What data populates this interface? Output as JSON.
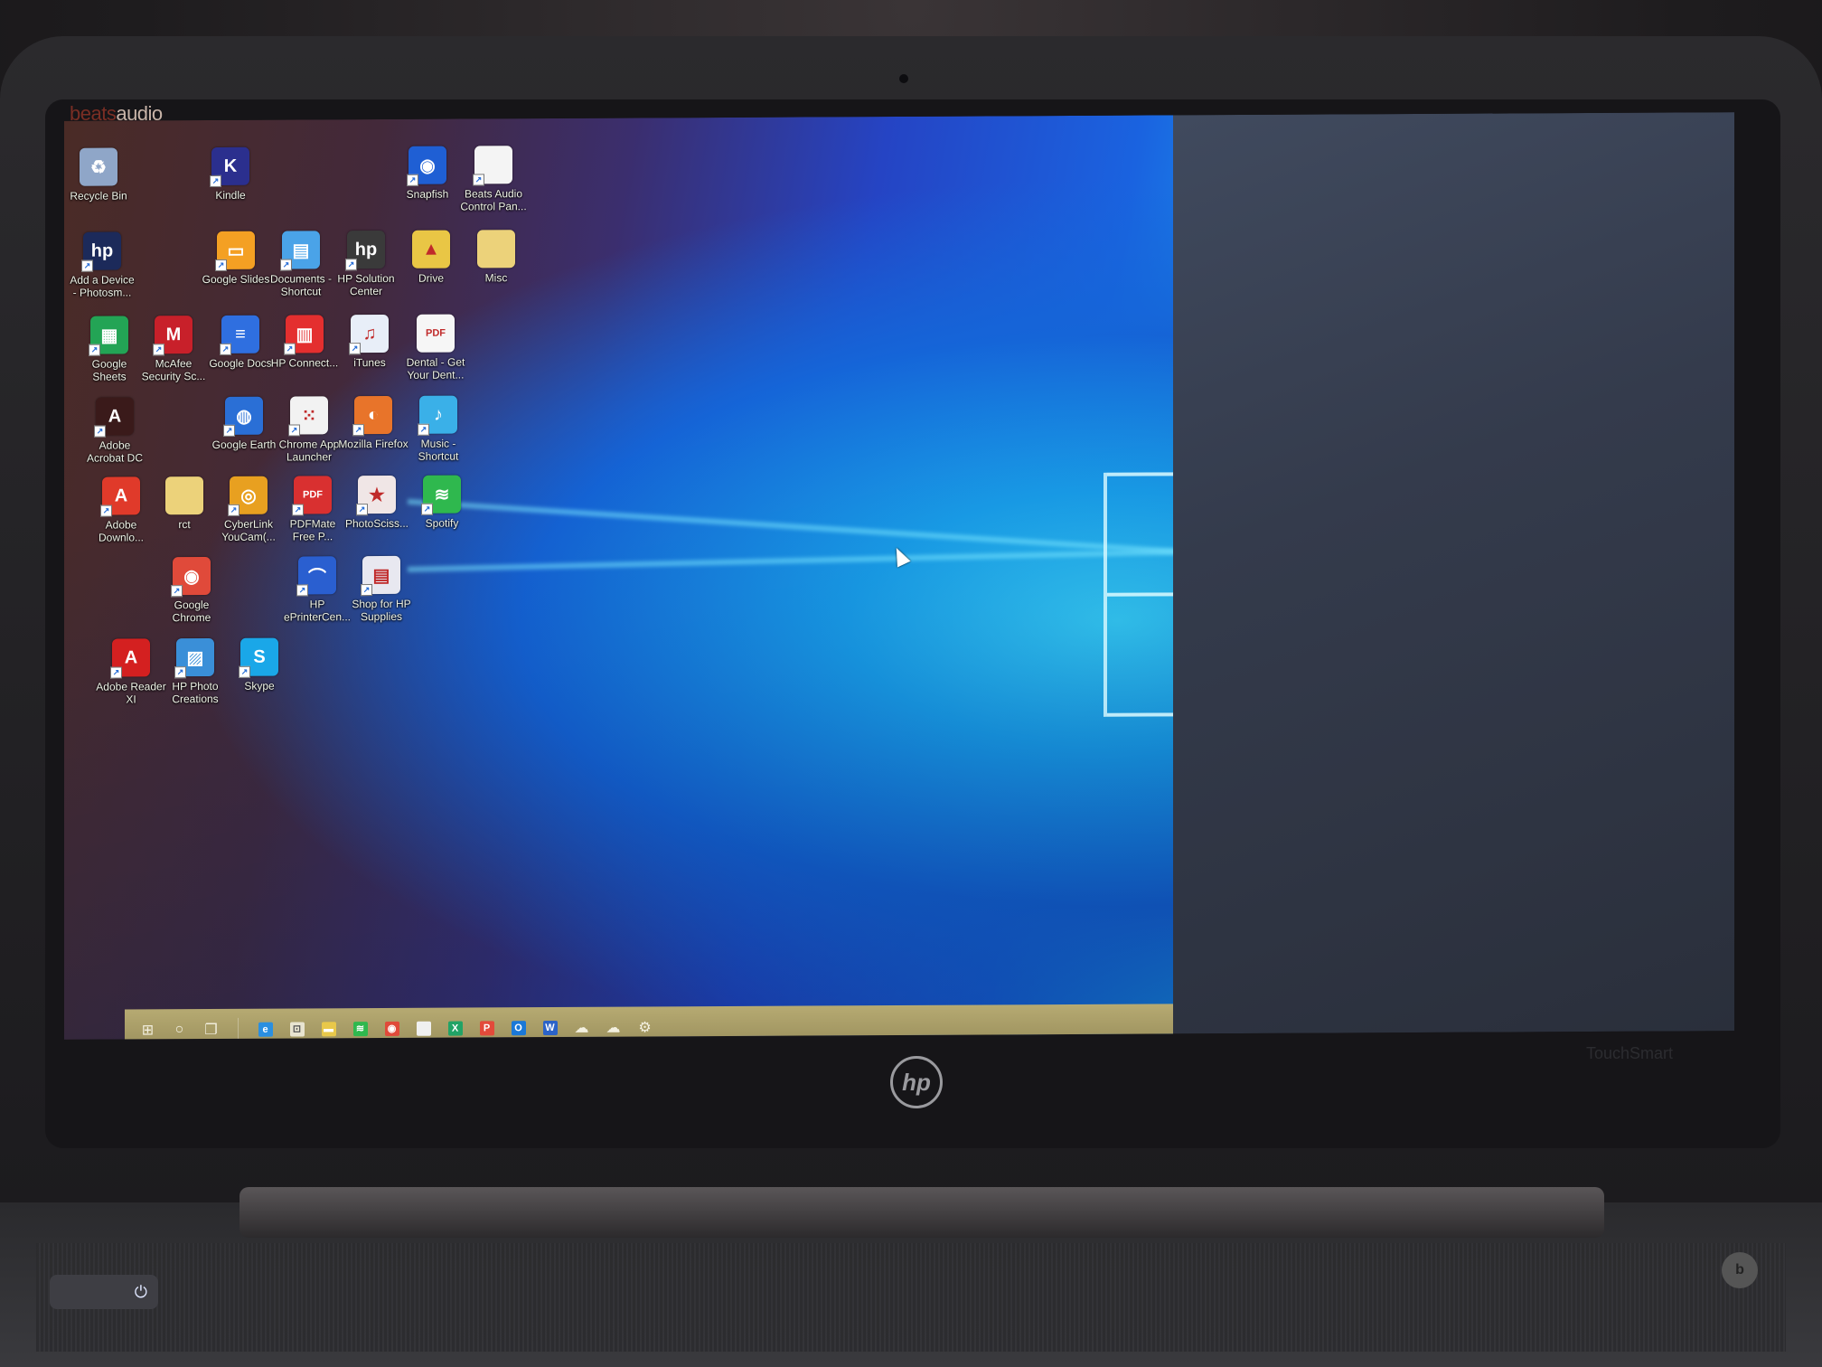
{
  "branding": {
    "brand_prefix": "beats",
    "brand_suffix": "audio",
    "laptop_logo": "hp",
    "model_label": "TouchSmart"
  },
  "desktop": {
    "icons": [
      {
        "label": "Recycle Bin",
        "icon": "recycle-bin-icon",
        "color": "#8fa6c8",
        "glyph": "♻",
        "shortcut": false
      },
      {
        "label": "Kindle",
        "icon": "kindle-icon",
        "color": "#2b2f8e",
        "glyph": "K",
        "shortcut": true
      },
      {
        "label": "Snapfish",
        "icon": "snapfish-icon",
        "color": "#1f5fd4",
        "glyph": "◉",
        "shortcut": true
      },
      {
        "label": "Beats Audio Control Pan...",
        "icon": "document-icon",
        "color": "#f4f4f4",
        "glyph": "",
        "shortcut": true
      },
      {
        "label": "Add a Device - Photosm...",
        "icon": "hp-icon",
        "color": "#1c2a5a",
        "glyph": "hp",
        "shortcut": true
      },
      {
        "label": "Google Slides",
        "icon": "google-slides-icon",
        "color": "#f4a023",
        "glyph": "▭",
        "shortcut": true
      },
      {
        "label": "Documents - Shortcut",
        "icon": "documents-icon",
        "color": "#4aa3e8",
        "glyph": "▤",
        "shortcut": true
      },
      {
        "label": "HP Solution Center",
        "icon": "hp-solution-center-icon",
        "color": "#3a3a3a",
        "glyph": "hp",
        "shortcut": true
      },
      {
        "label": "Drive",
        "icon": "folder-icon",
        "color": "#e9c645",
        "glyph": "▲",
        "shortcut": false
      },
      {
        "label": "Misc",
        "icon": "folder-icon",
        "color": "#ecd27a",
        "glyph": "",
        "shortcut": false
      },
      {
        "label": "Google Sheets",
        "icon": "google-sheets-icon",
        "color": "#23a455",
        "glyph": "▦",
        "shortcut": true
      },
      {
        "label": "McAfee Security Sc...",
        "icon": "mcafee-icon",
        "color": "#c8202a",
        "glyph": "M",
        "shortcut": true
      },
      {
        "label": "Google Docs",
        "icon": "google-docs-icon",
        "color": "#2f6fe0",
        "glyph": "≡",
        "shortcut": true
      },
      {
        "label": "HP Connect...",
        "icon": "hp-connected-music-icon",
        "color": "#e42f2f",
        "glyph": "▥",
        "shortcut": true
      },
      {
        "label": "iTunes",
        "icon": "itunes-icon",
        "color": "#e8eef8",
        "glyph": "♫",
        "shortcut": true
      },
      {
        "label": "Dental - Get Your Dent...",
        "icon": "pdf-icon",
        "color": "#f6f6f6",
        "glyph": "PDF",
        "shortcut": false
      },
      {
        "label": "Adobe Acrobat DC",
        "icon": "acrobat-icon",
        "color": "#3a1a1a",
        "glyph": "A",
        "shortcut": true
      },
      {
        "label": "Google Earth",
        "icon": "google-earth-icon",
        "color": "#2a6fd6",
        "glyph": "◍",
        "shortcut": true
      },
      {
        "label": "Chrome App Launcher",
        "icon": "chrome-app-launcher-icon",
        "color": "#f2f2f2",
        "glyph": "⁙",
        "shortcut": true
      },
      {
        "label": "Mozilla Firefox",
        "icon": "firefox-icon",
        "color": "#e8742a",
        "glyph": "◐",
        "shortcut": true
      },
      {
        "label": "Music - Shortcut",
        "icon": "music-icon",
        "color": "#3ab0e8",
        "glyph": "♪",
        "shortcut": true
      },
      {
        "label": "Adobe Downlo...",
        "icon": "adobe-icon",
        "color": "#e03a2a",
        "glyph": "A",
        "shortcut": true
      },
      {
        "label": "rct",
        "icon": "folder-icon",
        "color": "#ecd27a",
        "glyph": "",
        "shortcut": false
      },
      {
        "label": "CyberLink YouCam(...",
        "icon": "youcam-icon",
        "color": "#e8a020",
        "glyph": "◎",
        "shortcut": true
      },
      {
        "label": "PDFMate Free P...",
        "icon": "pdfmate-icon",
        "color": "#d93030",
        "glyph": "PDF",
        "shortcut": true
      },
      {
        "label": "PhotoSciss...",
        "icon": "photoscissors-icon",
        "color": "#f0e6e6",
        "glyph": "★",
        "shortcut": true
      },
      {
        "label": "Spotify",
        "icon": "spotify-icon",
        "color": "#2fb84e",
        "glyph": "≋",
        "shortcut": true
      },
      {
        "label": "Google Chrome",
        "icon": "chrome-icon",
        "color": "#e04a3a",
        "glyph": "◉",
        "shortcut": true
      },
      {
        "label": "HP ePrinterCen...",
        "icon": "hp-eprint-icon",
        "color": "#2a5fd0",
        "glyph": "⌒",
        "shortcut": true
      },
      {
        "label": "Shop for HP Supplies",
        "icon": "printer-icon",
        "color": "#e8e8f0",
        "glyph": "▤",
        "shortcut": true
      },
      {
        "label": "Adobe Reader XI",
        "icon": "adobe-reader-icon",
        "color": "#d42020",
        "glyph": "A",
        "shortcut": true
      },
      {
        "label": "HP Photo Creations",
        "icon": "hp-photo-creations-icon",
        "color": "#3a8fd8",
        "glyph": "▨",
        "shortcut": true
      },
      {
        "label": "Skype",
        "icon": "skype-icon",
        "color": "#1aa7e8",
        "glyph": "S",
        "shortcut": true
      }
    ]
  },
  "taskbar": {
    "items": [
      {
        "name": "start-button",
        "icon": "windows-icon",
        "glyph": "⊞",
        "color": "",
        "active": false
      },
      {
        "name": "cortana-button",
        "icon": "search-circle-icon",
        "glyph": "○",
        "color": "",
        "active": false
      },
      {
        "name": "task-view-button",
        "icon": "task-view-icon",
        "glyph": "❐",
        "color": "",
        "active": false
      },
      {
        "name": "edge-button",
        "icon": "edge-icon",
        "glyph": "e",
        "color": "#2a8fe0",
        "active": false
      },
      {
        "name": "store-button",
        "icon": "store-icon",
        "glyph": "⊡",
        "color": "#e8e4d0",
        "active": false
      },
      {
        "name": "file-explorer-button",
        "icon": "folder-icon",
        "glyph": "▬",
        "color": "#e8c84a",
        "active": false
      },
      {
        "name": "spotify-button",
        "icon": "spotify-icon",
        "glyph": "≋",
        "color": "#2fb84e",
        "active": false
      },
      {
        "name": "chrome-button",
        "icon": "chrome-icon",
        "glyph": "◉",
        "color": "#e04a3a",
        "active": true
      },
      {
        "name": "notepad-button",
        "icon": "blank-window-icon",
        "glyph": "",
        "color": "#f0f0f0",
        "active": false
      },
      {
        "name": "excel-button",
        "icon": "excel-icon",
        "glyph": "X",
        "color": "#21a366",
        "active": false
      },
      {
        "name": "powerpoint-button",
        "icon": "powerpoint-icon",
        "glyph": "P",
        "color": "#e34a3a",
        "active": false
      },
      {
        "name": "outlook-button",
        "icon": "outlook-icon",
        "glyph": "O",
        "color": "#1a78d8",
        "active": false
      },
      {
        "name": "word-button",
        "icon": "word-icon",
        "glyph": "W",
        "color": "#2b63c8",
        "active": false
      },
      {
        "name": "app-button-1",
        "icon": "cloud-icon",
        "glyph": "☁",
        "color": "",
        "active": false
      },
      {
        "name": "app-button-2",
        "icon": "cloud-icon",
        "glyph": "☁",
        "color": "",
        "active": false
      },
      {
        "name": "settings-button",
        "icon": "gear-icon",
        "glyph": "⚙",
        "color": "",
        "active": true
      }
    ]
  },
  "power_glyph": "⏻",
  "beats_glyph": "b"
}
